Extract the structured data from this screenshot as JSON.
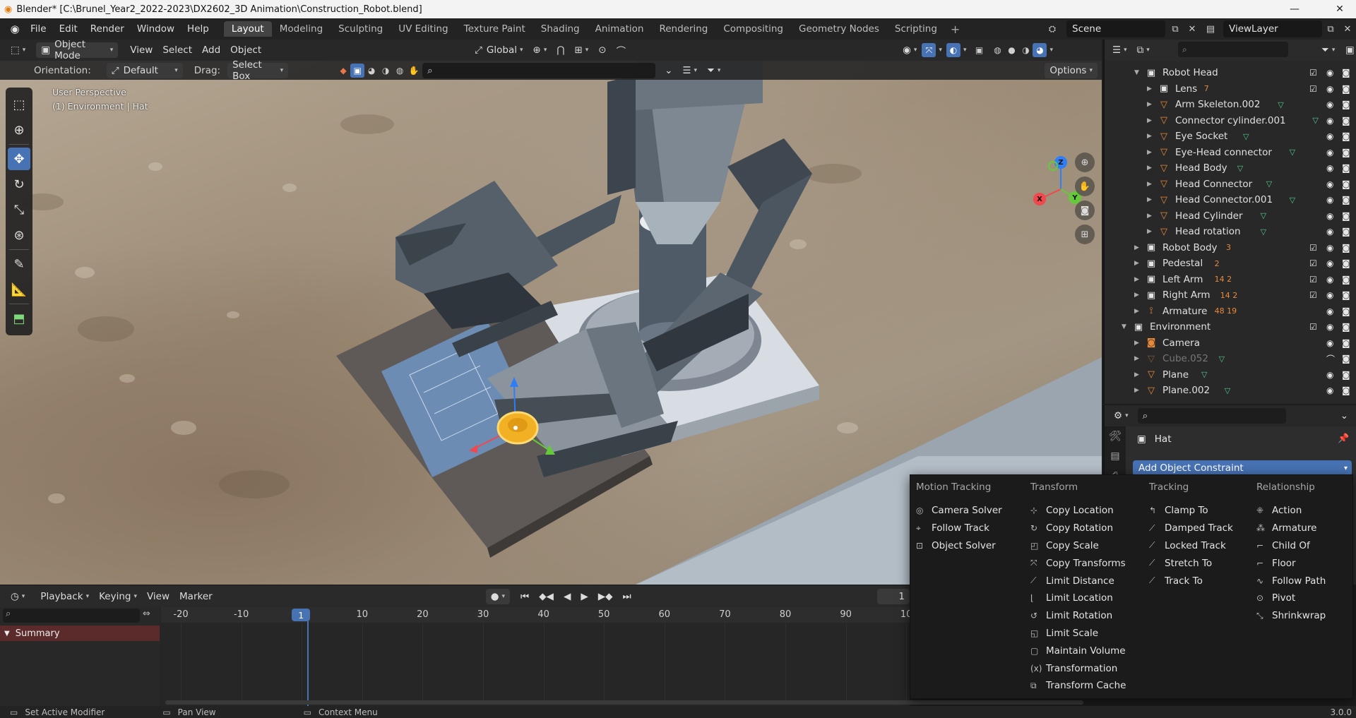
{
  "window": {
    "title": "Blender* [C:\\Brunel_Year2_2022-2023\\DX2602_3D Animation\\Construction_Robot.blend]",
    "min": "—",
    "max": "▢",
    "close": "✕"
  },
  "menu": [
    "File",
    "Edit",
    "Render",
    "Window",
    "Help"
  ],
  "workspaces": [
    "Layout",
    "Modeling",
    "Sculpting",
    "UV Editing",
    "Texture Paint",
    "Shading",
    "Animation",
    "Rendering",
    "Compositing",
    "Geometry Nodes",
    "Scripting"
  ],
  "active_workspace": "Layout",
  "scene": "Scene",
  "view_layer": "ViewLayer",
  "viewport_header": {
    "mode": "Object Mode",
    "menus": [
      "View",
      "Select",
      "Add",
      "Object"
    ],
    "transform_orientation": "Global",
    "orientation_label": "Orientation:",
    "orientation_value": "Default",
    "drag_label": "Drag:",
    "drag_value": "Select Box",
    "options": "Options"
  },
  "viewport_overlay": {
    "line1": "User Perspective",
    "line2": "(1) Environment | Hat"
  },
  "gizmo": {
    "x": "X",
    "y": "Y",
    "z": "Z"
  },
  "outliner": {
    "rows": [
      {
        "name": "Robot Head",
        "type": "collection",
        "level": 1,
        "open": true,
        "badge": ""
      },
      {
        "name": "Lens",
        "type": "collection",
        "level": 2,
        "open": false,
        "badge": "7"
      },
      {
        "name": "Arm Skeleton.002",
        "type": "mesh",
        "level": 2,
        "open": false,
        "badge": ""
      },
      {
        "name": "Connector cylinder.001",
        "type": "mesh",
        "level": 2,
        "open": false,
        "badge": ""
      },
      {
        "name": "Eye Socket",
        "type": "mesh",
        "level": 2,
        "open": false,
        "badge": ""
      },
      {
        "name": "Eye-Head connector",
        "type": "mesh",
        "level": 2,
        "open": false,
        "badge": ""
      },
      {
        "name": "Head Body",
        "type": "mesh",
        "level": 2,
        "open": false,
        "badge": ""
      },
      {
        "name": "Head Connector",
        "type": "mesh",
        "level": 2,
        "open": false,
        "badge": ""
      },
      {
        "name": "Head Connector.001",
        "type": "mesh",
        "level": 2,
        "open": false,
        "badge": ""
      },
      {
        "name": "Head Cylinder",
        "type": "mesh",
        "level": 2,
        "open": false,
        "badge": ""
      },
      {
        "name": "Head rotation",
        "type": "mesh",
        "level": 2,
        "open": false,
        "badge": ""
      },
      {
        "name": "Robot Body",
        "type": "collection",
        "level": 1,
        "open": false,
        "badge": "3"
      },
      {
        "name": "Pedestal",
        "type": "collection",
        "level": 1,
        "open": false,
        "badge": "2"
      },
      {
        "name": "Left Arm",
        "type": "collection",
        "level": 1,
        "open": false,
        "badge": "14  2"
      },
      {
        "name": "Right Arm",
        "type": "collection",
        "level": 1,
        "open": false,
        "badge": "14  2"
      },
      {
        "name": "Armature",
        "type": "armature",
        "level": 1,
        "open": false,
        "badge": "48  19"
      },
      {
        "name": "Environment",
        "type": "collection",
        "level": 0,
        "open": true,
        "badge": ""
      },
      {
        "name": "Camera",
        "type": "camera",
        "level": 1,
        "open": false,
        "badge": ""
      },
      {
        "name": "Cube.052",
        "type": "mesh",
        "level": 1,
        "open": false,
        "badge": "",
        "hidden": true
      },
      {
        "name": "Plane",
        "type": "mesh",
        "level": 1,
        "open": false,
        "badge": ""
      },
      {
        "name": "Plane.002",
        "type": "mesh",
        "level": 1,
        "open": false,
        "badge": ""
      }
    ]
  },
  "properties": {
    "object_name": "Hat",
    "add_constraint": "Add Object Constraint"
  },
  "constraint_menu": {
    "columns": [
      {
        "title": "Motion Tracking",
        "items": [
          {
            "label": "Camera Solver",
            "icon": "◎"
          },
          {
            "label": "Follow Track",
            "icon": "⌖"
          },
          {
            "label": "Object Solver",
            "icon": "⊡"
          }
        ]
      },
      {
        "title": "Transform",
        "items": [
          {
            "label": "Copy Location",
            "icon": "⊹"
          },
          {
            "label": "Copy Rotation",
            "icon": "↻"
          },
          {
            "label": "Copy Scale",
            "icon": "◰"
          },
          {
            "label": "Copy Transforms",
            "icon": "⤧"
          },
          {
            "label": "Limit Distance",
            "icon": "⟋"
          },
          {
            "label": "Limit Location",
            "icon": "⌊"
          },
          {
            "label": "Limit Rotation",
            "icon": "↺"
          },
          {
            "label": "Limit Scale",
            "icon": "◱"
          },
          {
            "label": "Maintain Volume",
            "icon": "▢"
          },
          {
            "label": "Transformation",
            "icon": "(x)"
          },
          {
            "label": "Transform Cache",
            "icon": "⧉"
          }
        ]
      },
      {
        "title": "Tracking",
        "items": [
          {
            "label": "Clamp To",
            "icon": "↰"
          },
          {
            "label": "Damped Track",
            "icon": "⟋"
          },
          {
            "label": "Locked Track",
            "icon": "⟋"
          },
          {
            "label": "Stretch To",
            "icon": "⟋"
          },
          {
            "label": "Track To",
            "icon": "⟋"
          }
        ]
      },
      {
        "title": "Relationship",
        "items": [
          {
            "label": "Action",
            "icon": "⁜"
          },
          {
            "label": "Armature",
            "icon": "⁂"
          },
          {
            "label": "Child Of",
            "icon": "⌐"
          },
          {
            "label": "Floor",
            "icon": "⌐"
          },
          {
            "label": "Follow Path",
            "icon": "∿"
          },
          {
            "label": "Pivot",
            "icon": "⊙"
          },
          {
            "label": "Shrinkwrap",
            "icon": "⤡"
          }
        ]
      }
    ]
  },
  "timeline": {
    "menus": [
      "Playback",
      "Keying",
      "View",
      "Marker"
    ],
    "current_frame": "1",
    "frame_field": "1",
    "ticks": [
      "-20",
      "-10",
      "1",
      "10",
      "20",
      "30",
      "40",
      "50",
      "60",
      "70",
      "80",
      "90",
      "10"
    ],
    "summary": "Summary"
  },
  "statusbar": {
    "left": "Set Active Modifier",
    "middle": "Pan View",
    "right": "Context Menu",
    "version": "3.0.0"
  }
}
